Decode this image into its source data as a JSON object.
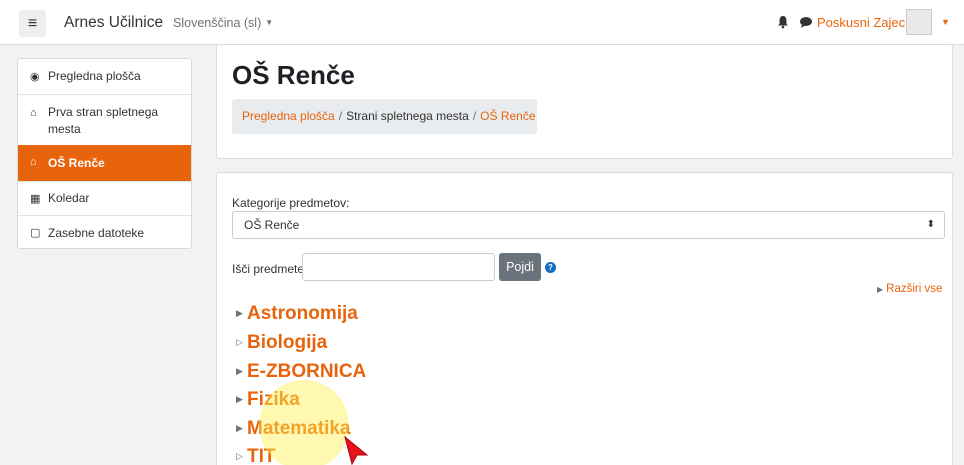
{
  "header": {
    "menu_icon": "hamburger-icon",
    "brand": "Arnes Učilnice",
    "language": "Slovenščina (sl)",
    "notifications_icon": "bell-icon",
    "messages_icon": "chat-icon",
    "user_name": "Poskusni Zajec"
  },
  "sidebar": {
    "items": [
      {
        "label": "Pregledna plošča",
        "icon": "dashboard-icon"
      },
      {
        "label": "Prva stran spletnega mesta",
        "icon": "home-icon"
      },
      {
        "label": "OŠ Renče",
        "icon": "home-icon",
        "active": true
      },
      {
        "label": "Koledar",
        "icon": "calendar-icon"
      },
      {
        "label": "Zasebne datoteke",
        "icon": "file-icon"
      }
    ]
  },
  "main": {
    "title": "OŠ Renče",
    "breadcrumb": [
      "Pregledna plošča",
      "Strani spletnega mesta",
      "OŠ Renče"
    ],
    "category_label": "Kategorije predmetov:",
    "category_selected": "OŠ Renče",
    "search_label": "Išči predmete",
    "search_value": "",
    "search_button": "Pojdi",
    "help_icon": "help-icon",
    "expand_all": "Razširi vse",
    "courses": [
      "Astronomija",
      "Biologija",
      "E-ZBORNICA",
      "Fizika",
      "Matematika",
      "TIT"
    ]
  },
  "colors": {
    "accent": "#e8640c",
    "button": "#6a737b"
  }
}
